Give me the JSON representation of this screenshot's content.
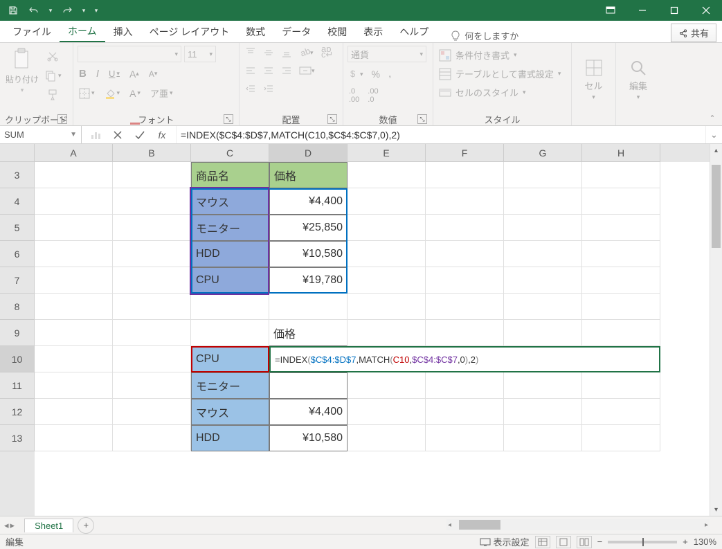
{
  "qat": {
    "save": "save",
    "undo": "undo",
    "redo": "redo"
  },
  "window": {
    "minimize": "−",
    "maximize": "□",
    "close": "✕",
    "ribbon_opts": "▾"
  },
  "tabs": {
    "file": "ファイル",
    "home": "ホーム",
    "insert": "挿入",
    "layout": "ページ レイアウト",
    "formulas": "数式",
    "data": "データ",
    "review": "校閲",
    "view": "表示",
    "help": "ヘルプ",
    "tellme": "何をしますか",
    "share": "共有"
  },
  "ribbon": {
    "clipboard": {
      "label": "クリップボード",
      "paste": "貼り付け"
    },
    "font": {
      "label": "フォント",
      "size": "11",
      "bold": "B",
      "italic": "I",
      "underline": "U"
    },
    "align": {
      "label": "配置"
    },
    "number": {
      "label": "数値",
      "format": "通貨"
    },
    "styles": {
      "label": "スタイル",
      "cond": "条件付き書式",
      "table": "テーブルとして書式設定",
      "cell": "セルのスタイル"
    },
    "cells": {
      "label": "セル"
    },
    "editing": {
      "label": "編集"
    }
  },
  "namebox": "SUM",
  "formula_plain": "=INDEX($C$4:$D$7,MATCH(C10,$C$4:$C$7,0),2)",
  "formula_parts": {
    "p1": "=INDEX",
    "p2": "(",
    "ref1": "$C$4:$D$7",
    "p3": ",MATCH",
    "p4": "(",
    "ref2": "C10",
    "p5": ",",
    "ref3": "$C$4:$C$7",
    "p6": ",0",
    "p7": ")",
    "p8": ",2",
    "p9": ")"
  },
  "cols": [
    "A",
    "B",
    "C",
    "D",
    "E",
    "F",
    "G",
    "H"
  ],
  "rows": [
    "3",
    "4",
    "5",
    "6",
    "7",
    "8",
    "9",
    "10",
    "11",
    "12",
    "13"
  ],
  "cells": {
    "C3": "商品名",
    "D3": "価格",
    "C4": "マウス",
    "D4": "¥4,400",
    "C5": "モニター",
    "D5": "¥25,850",
    "C6": "HDD",
    "D6": "¥10,580",
    "C7": "CPU",
    "D7": "¥19,780",
    "D9": "価格",
    "C10": "CPU",
    "C11": "モニター",
    "C12": "マウス",
    "D12": "¥4,400",
    "C13": "HDD",
    "D13": "¥10,580"
  },
  "sheet_tab": "Sheet1",
  "status": {
    "mode": "編集",
    "display": "表示設定",
    "zoom": "130%"
  },
  "colw": {
    "A": 113,
    "B": 113,
    "C": 113,
    "D": 113,
    "E": 113,
    "F": 113,
    "G": 113,
    "H": 113
  }
}
